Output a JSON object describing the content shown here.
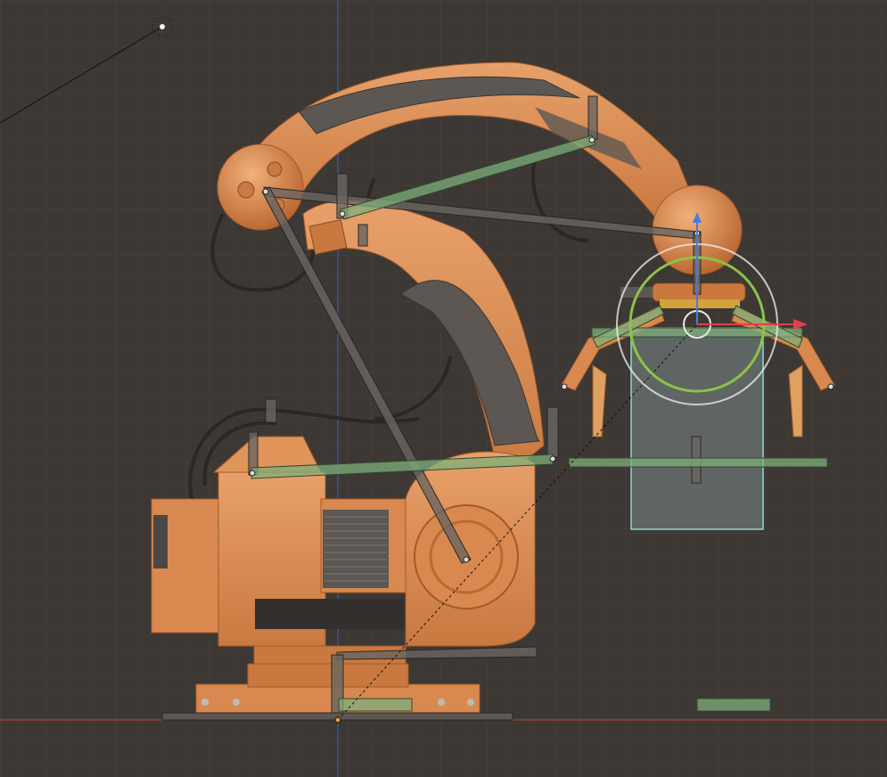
{
  "viewport": {
    "background": "#3d3834",
    "grid_color": "#47423d",
    "x_axis_color": "#b5463e",
    "z_axis_color": "#3f5fc7"
  },
  "colors": {
    "robot_orange": "#d9894f",
    "robot_orange_light": "#e8a06a",
    "robot_orange_dark": "#b86a35",
    "bone_gray": "#6a6560",
    "bone_green": "#7fae7a",
    "selection_cyan": "#8fd9d4",
    "gizmo_white": "#e8e8e8",
    "gizmo_green": "#8bc34a",
    "gizmo_red": "#e0404a",
    "gizmo_blue": "#4a7ae0",
    "cable": "#2a2724"
  },
  "icons": {
    "light": "sun-light-icon",
    "origin": "object-origin-icon",
    "rotate_gizmo": "rotate-gizmo-icon"
  }
}
